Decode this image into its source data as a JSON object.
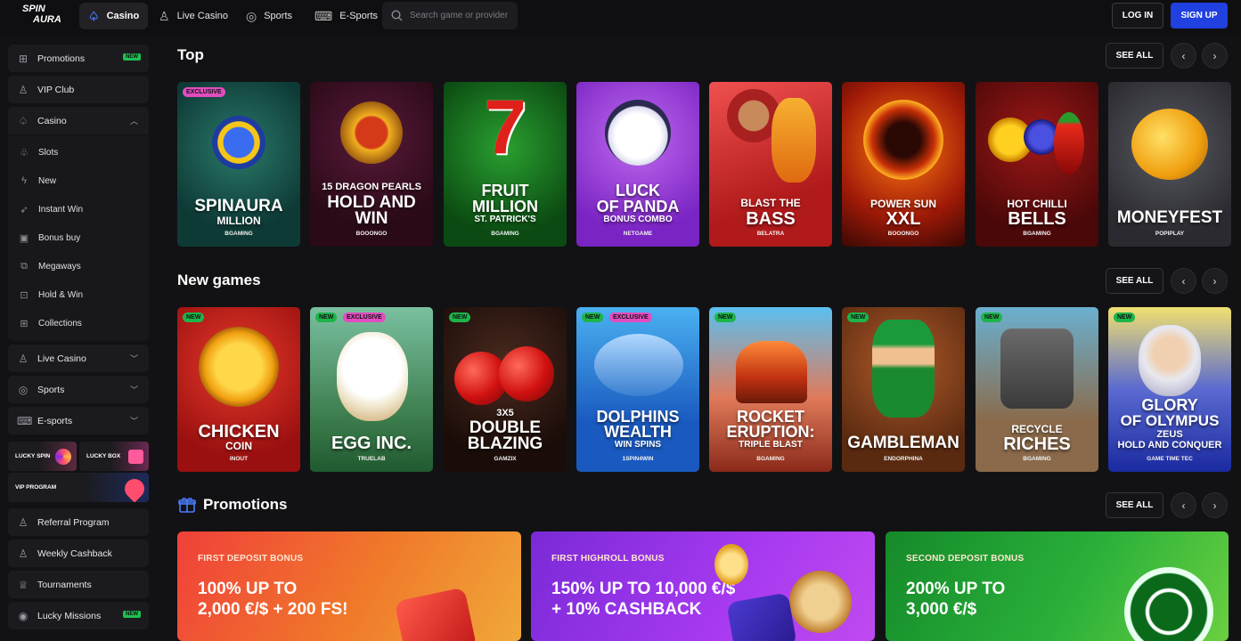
{
  "brand": {
    "line1": "SPIN",
    "line2": "AURA"
  },
  "nav": {
    "tabs": [
      {
        "label": "Casino",
        "icon": "casino-icon"
      },
      {
        "label": "Live Casino",
        "icon": "dealer-icon"
      },
      {
        "label": "Sports",
        "icon": "ball-icon"
      },
      {
        "label": "E-Sports",
        "icon": "gamepad-icon"
      }
    ],
    "search_placeholder": "Search game or provider",
    "login": "LOG IN",
    "signup": "SIGN UP"
  },
  "sidebar": {
    "promotions": "Promotions",
    "new_badge": "NEW",
    "vip": "VIP Club",
    "casino": "Casino",
    "sub": [
      "Slots",
      "New",
      "Instant Win",
      "Bonus buy",
      "Megaways",
      "Hold & Win",
      "Collections"
    ],
    "live_casino": "Live Casino",
    "sports": "Sports",
    "esports": "E-sports",
    "lucky_spin": "LUCKY SPIN",
    "lucky_box": "LUCKY BOX",
    "vip_program": "VIP PROGRAM",
    "referral": "Referral Program",
    "cashback": "Weekly Cashback",
    "tournaments": "Tournaments",
    "missions": "Lucky Missions"
  },
  "sections": {
    "top": "Top",
    "new_games": "New games",
    "promotions": "Promotions",
    "see_all": "SEE ALL"
  },
  "top_games": [
    {
      "l1": "SPINAURA",
      "l2": "MILLION",
      "prov": "BGAMING",
      "tag": "EXCLUSIVE"
    },
    {
      "l0": "15 DRAGON PEARLS",
      "l1": "HOLD AND",
      "l2": "WIN",
      "prov": "BOOONGO"
    },
    {
      "l0": "",
      "l1": "FRUIT",
      "l2": "MILLION",
      "l3": "ST. PATRICK'S",
      "prov": "BGAMING",
      "big": "7"
    },
    {
      "l1": "LUCK",
      "l2": "OF PANDA",
      "l3": "BONUS COMBO",
      "prov": "NETGAME"
    },
    {
      "l0": "BLAST THE",
      "l1": "BASS",
      "prov": "BELATRA"
    },
    {
      "l0": "POWER SUN",
      "l1": "XXL",
      "prov": "BOOONGO"
    },
    {
      "l0": "HOT CHILLI",
      "l1": "BELLS",
      "prov": "BGAMING"
    },
    {
      "l1": "MONEYFEST",
      "prov": "POPIPLAY"
    }
  ],
  "new_games": [
    {
      "l1": "CHICKEN",
      "l2": "COIN",
      "prov": "INOUT",
      "tags": [
        "NEW"
      ]
    },
    {
      "l1": "EGG INC.",
      "prov": "TRUELAB",
      "tags": [
        "NEW",
        "EXCLUSIVE"
      ]
    },
    {
      "l0": "3X5",
      "l1": "DOUBLE",
      "l2": "BLAZING",
      "prov": "GAMZIX",
      "tags": [
        "NEW"
      ]
    },
    {
      "l1": "DOLPHINS",
      "l2": "WEALTH",
      "l3": "WIN SPINS",
      "prov": "1SPIN4WIN",
      "tags": [
        "NEW",
        "EXCLUSIVE"
      ]
    },
    {
      "l1": "ROCKET",
      "l2": "ERUPTION:",
      "l3": "TRIPLE BLAST",
      "prov": "BGAMING",
      "tags": [
        "NEW"
      ]
    },
    {
      "l1": "GAMBLEMAN",
      "prov": "ENDORPHINA",
      "tags": [
        "NEW"
      ]
    },
    {
      "l0": "RECYCLE",
      "l1": "RICHES",
      "prov": "BGAMING",
      "tags": [
        "NEW"
      ]
    },
    {
      "l1": "GLORY",
      "l2": "OF OLYMPUS",
      "l3": "ZEUS",
      "l4": "HOLD AND CONQUER",
      "prov": "GAME TIME TEC",
      "tags": [
        "NEW"
      ]
    }
  ],
  "promos": [
    {
      "label": "FIRST DEPOSIT BONUS",
      "line1": "100% UP TO",
      "line2": "2,000 €/$ + 200 FS!"
    },
    {
      "label": "FIRST HIGHROLL BONUS",
      "line1": "150% UP TO 10,000 €/$",
      "line2": "+ 10% CASHBACK"
    },
    {
      "label": "SECOND DEPOSIT BONUS",
      "line1": "200% UP TO",
      "line2": "3,000 €/$"
    }
  ]
}
